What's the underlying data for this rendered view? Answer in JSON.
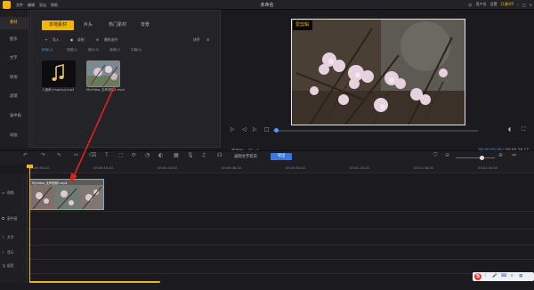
{
  "titlebar": {
    "menu": [
      "文件",
      "编辑",
      "导出",
      "帮助"
    ],
    "title": "未命名",
    "right": {
      "user": "用户名",
      "settings": "设置",
      "vip": "开通VIP",
      "export": "导出"
    }
  },
  "left_tabs": [
    "素材",
    "配乐",
    "文字",
    "转场",
    "滤镜",
    "画中画",
    "动画",
    "贴纸"
  ],
  "media": {
    "tabs": [
      "本地素材",
      "片头",
      "热门素材",
      "背景"
    ],
    "tools": {
      "import": "导入",
      "record": "录制",
      "delete_selected": "删除选中",
      "sort": "排序"
    },
    "filters": [
      "所有(2)",
      "视频(1)",
      "图片(0)",
      "音频(1)",
      "字幕(0)"
    ],
    "items": [
      {
        "caption": "人造雨 (mgnioj).mp3",
        "kind": "audio"
      },
      {
        "caption": "MyVideo_无声视频1.mp4",
        "kind": "video"
      }
    ]
  },
  "preview": {
    "badge": "爱剪辑",
    "ratio_label": "宽高比：",
    "ratio_value": "16 : 9",
    "time_current": "00:00:00.00",
    "time_total": "/ 00:00:18.17"
  },
  "timeline": {
    "recorder": "录制文字旁白",
    "export": "导出",
    "ticks": [
      "00:00:00.00",
      "00:00:16.00",
      "00:00:32.00",
      "00:00:48.00",
      "00:01:04.00",
      "00:01:20.00",
      "00:01:36.00",
      "00:01:52.00"
    ],
    "tracks": [
      "视频",
      "画中画",
      "文字",
      "音乐",
      "配音"
    ],
    "clip_label": "MyVideo_无声视频1.mp4"
  }
}
